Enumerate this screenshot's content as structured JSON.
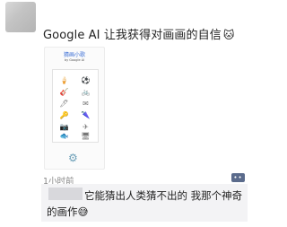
{
  "post": {
    "text": "Google AI 让我获得对画画的自信",
    "emoji": "🐱"
  },
  "screenshot": {
    "logo_text": "猜画小歌",
    "subtitle": "by Google AI",
    "doodles": [
      "🍦",
      "⚽",
      "🎸",
      "🚲",
      "🖊",
      "✉",
      "🔑",
      "🌂",
      "📷",
      "✈",
      "🐟",
      "🖥"
    ]
  },
  "meta": {
    "time": "1小时前",
    "more_label": "••"
  },
  "comment": {
    "text_line1": "它能猜出人类猜不出的 我那个神奇",
    "text_line2": "的画作",
    "emoji": "😅"
  }
}
